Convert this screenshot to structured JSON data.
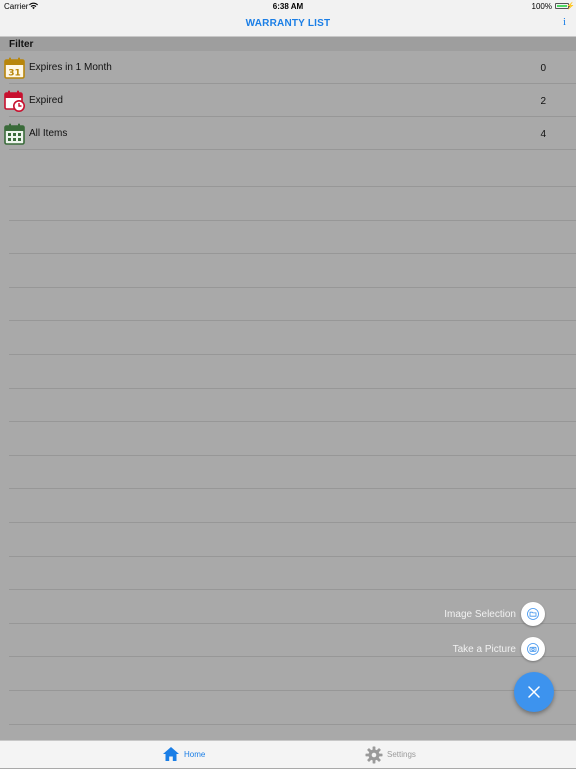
{
  "status_bar": {
    "carrier": "Carrier",
    "time": "6:38 AM",
    "battery": "100%"
  },
  "nav": {
    "title": "WARRANTY LIST",
    "info_label": "i"
  },
  "filter": {
    "header": "Filter",
    "items": [
      {
        "label": "Expires in 1 Month",
        "count": "0",
        "icon": "calendar-31-icon",
        "icon_text": "31",
        "color": "#b8860b"
      },
      {
        "label": "Expired",
        "count": "2",
        "icon": "calendar-clock-icon",
        "color": "#c8102e"
      },
      {
        "label": "All Items",
        "count": "4",
        "icon": "calendar-grid-icon",
        "color": "#3a6b3a"
      }
    ]
  },
  "fab": {
    "options": [
      {
        "label": "Image Selection",
        "icon": "folder-icon"
      },
      {
        "label": "Take a Picture",
        "icon": "camera-icon"
      }
    ],
    "main_icon": "close-icon",
    "accent": "#3d93ee"
  },
  "tab_bar": {
    "tabs": [
      {
        "label": "Home",
        "icon": "home-icon",
        "selected": true
      },
      {
        "label": "Settings",
        "icon": "gear-icon",
        "selected": false
      }
    ],
    "active_color": "#1a7ee6",
    "inactive_color": "#9a9a9a"
  }
}
